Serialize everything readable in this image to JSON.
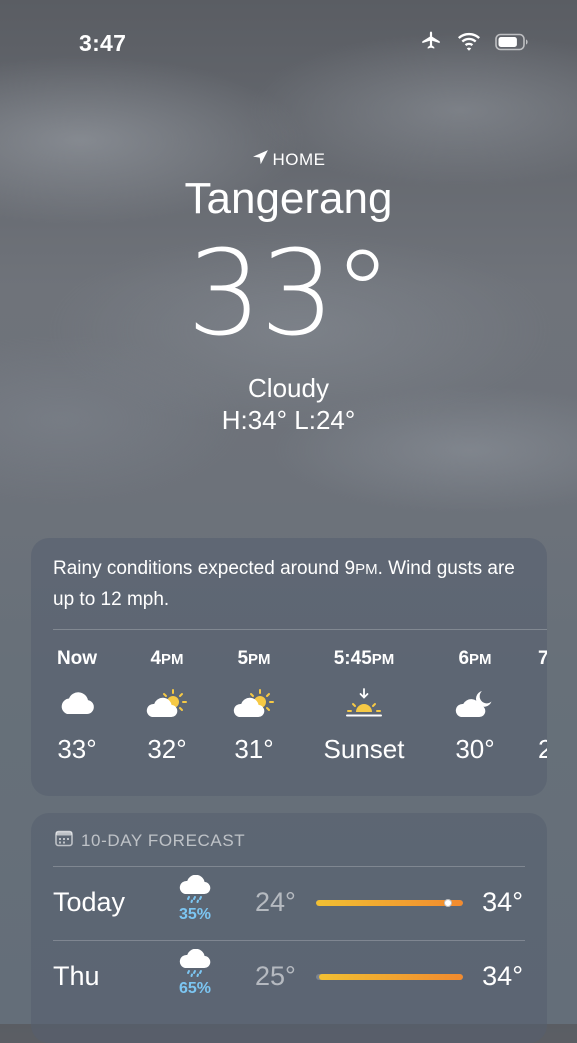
{
  "status_bar": {
    "time": "3:47",
    "icons": [
      "airplane-icon",
      "wifi-icon",
      "battery-icon"
    ],
    "battery_level": 0.8
  },
  "location": {
    "home_label": "HOME",
    "icon": "location-arrow-icon",
    "city": "Tangerang",
    "temperature": "33°",
    "condition": "Cloudy",
    "high_low": "H:34°  L:24°"
  },
  "hourly": {
    "summary_before": "Rainy conditions expected around 9",
    "summary_pm": "PM",
    "summary_after": ". Wind gusts are up to 12 mph.",
    "items": [
      {
        "label_main": "Now",
        "label_suffix": "",
        "icon": "cloud-icon",
        "temp": "33°"
      },
      {
        "label_main": "4",
        "label_suffix": "PM",
        "icon": "partly-cloudy-sun-icon",
        "temp": "32°"
      },
      {
        "label_main": "5",
        "label_suffix": "PM",
        "icon": "partly-cloudy-sun-icon",
        "temp": "31°"
      },
      {
        "label_main": "5:45",
        "label_suffix": "PM",
        "icon": "sunset-icon",
        "temp": "Sunset"
      },
      {
        "label_main": "6",
        "label_suffix": "PM",
        "icon": "partly-cloudy-moon-icon",
        "temp": "30°"
      },
      {
        "label_main": "7",
        "label_suffix": "",
        "icon": "",
        "temp": "2"
      }
    ]
  },
  "daily": {
    "header": "10-DAY FORECAST",
    "header_icon": "calendar-icon",
    "range_min": 24,
    "range_max": 34,
    "items": [
      {
        "day": "Today",
        "icon": "cloud-rain-icon",
        "precip": "35%",
        "low": "24°",
        "high": "34°",
        "bar_start": 0.0,
        "bar_end": 1.0,
        "current_marker": 0.9
      },
      {
        "day": "Thu",
        "icon": "cloud-rain-icon",
        "precip": "65%",
        "low": "25°",
        "high": "34°",
        "bar_start": 0.02,
        "bar_end": 1.0
      }
    ]
  },
  "colors": {
    "precip_blue": "#7cc6f2",
    "sun_yellow": "#f6c945",
    "bar_start": "#f2c032",
    "bar_end": "#f28a2e"
  }
}
